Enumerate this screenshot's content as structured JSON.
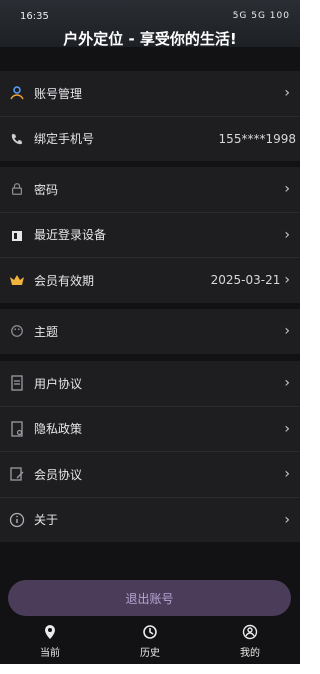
{
  "status": {
    "time": "16:35",
    "icons_text": "5G 5G 100"
  },
  "header": {
    "title": "户外定位 - 享受你的生活!"
  },
  "groups": [
    {
      "items": [
        {
          "label": "账号管理",
          "icon": "person-icon"
        },
        {
          "label": "绑定手机号",
          "value": "155****1998",
          "icon": "phone-icon"
        }
      ]
    },
    {
      "items": [
        {
          "label": "密码",
          "icon": "lock-icon"
        },
        {
          "label": "最近登录设备",
          "icon": "device-icon"
        },
        {
          "label": "会员有效期",
          "value": "2025-03-21",
          "icon": "crown-icon"
        }
      ]
    },
    {
      "items": [
        {
          "label": "主题",
          "icon": "palette-icon"
        }
      ]
    },
    {
      "items": [
        {
          "label": "用户协议",
          "icon": "document-icon"
        },
        {
          "label": "隐私政策",
          "icon": "privacy-icon"
        },
        {
          "label": "会员协议",
          "icon": "agreement-icon"
        },
        {
          "label": "关于",
          "icon": "info-icon"
        }
      ]
    }
  ],
  "logout": {
    "label": "退出账号"
  },
  "nav": [
    {
      "label": "当前",
      "icon": "location-pin-icon"
    },
    {
      "label": "历史",
      "icon": "history-icon"
    },
    {
      "label": "我的",
      "icon": "profile-icon"
    }
  ],
  "colors": {
    "background": "#121214",
    "row_background": "#1e1e21",
    "accent": "#4b3c5a",
    "accent_text": "#b6a6d3",
    "crown": "#f2b33c"
  }
}
